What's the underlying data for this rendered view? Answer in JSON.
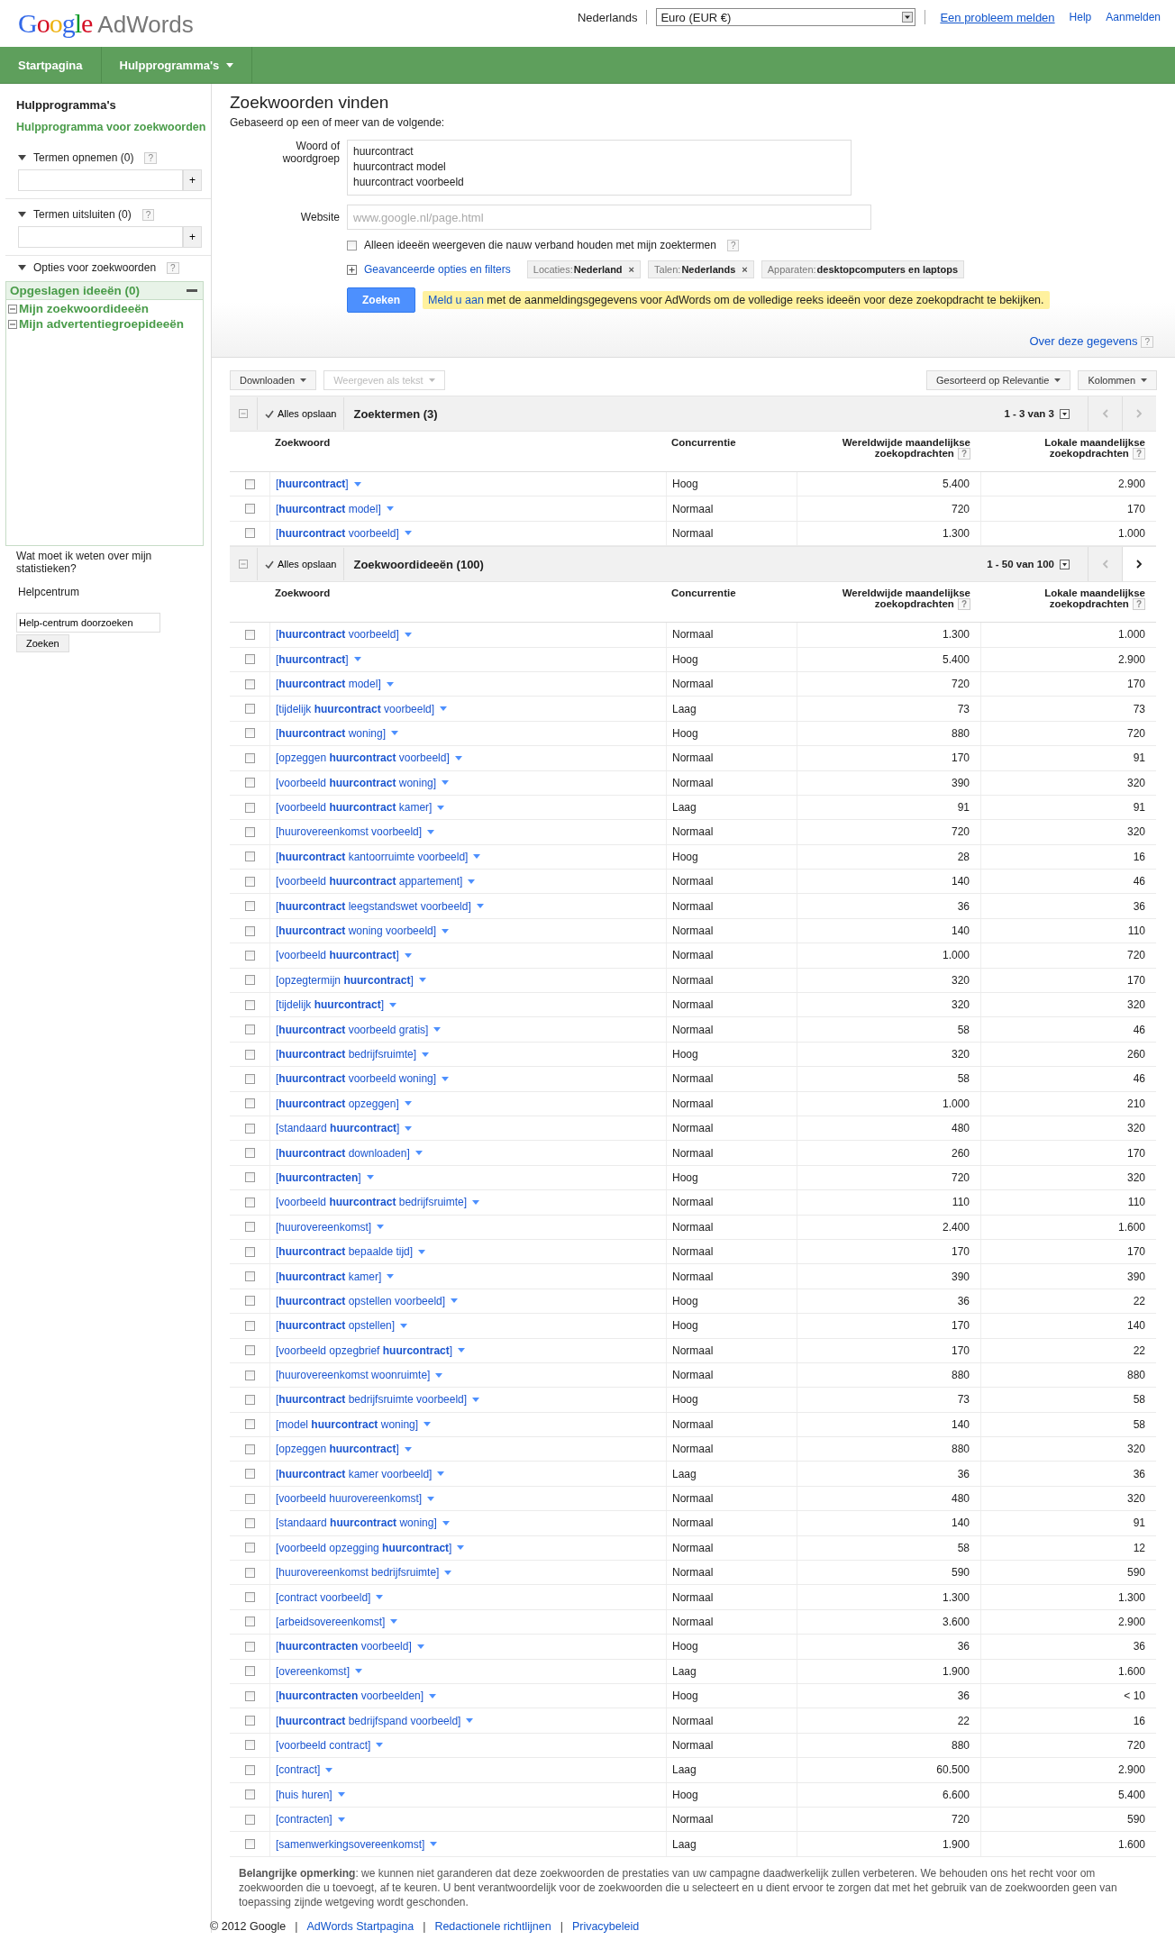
{
  "header": {
    "logo": {
      "brand": "Google",
      "product": "AdWords"
    },
    "language": "Nederlands",
    "currency": "Euro (EUR €)",
    "links": [
      "Een probleem melden",
      "Help",
      "Aanmelden"
    ]
  },
  "nav": [
    {
      "label": "Startpagina",
      "dropdown": false
    },
    {
      "label": "Hulpprogramma's",
      "dropdown": true
    }
  ],
  "sidebar": {
    "title": "Hulpprogramma's",
    "tool_link": "Hulpprogramma voor zoekwoorden",
    "term_sections": [
      {
        "label": "Termen opnemen (0)",
        "help": "?",
        "add": "+"
      },
      {
        "label": "Termen uitsluiten (0)",
        "help": "?",
        "add": "+"
      }
    ],
    "options": {
      "label": "Opties voor zoekwoorden",
      "help": "?"
    },
    "saved": {
      "title": "Opgeslagen ideeën (0)",
      "items": [
        "Mijn zoekwoordideeën",
        "Mijn advertentiegroepideeën"
      ]
    },
    "help_question": "Wat moet ik weten over mijn statistieken?",
    "help_center": "Helpcentrum",
    "help_search": {
      "value": "Help-centrum doorzoeken"
    },
    "help_button": "Zoeken"
  },
  "form": {
    "title": "Zoekwoorden vinden",
    "subtitle": "Gebaseerd op een of meer van de volgende:",
    "words_label": "Woord of woordgroep",
    "words": [
      "huurcontract",
      "huurcontract model",
      "huurcontract voorbeeld"
    ],
    "website_label": "Website",
    "website": {
      "placeholder": "www.google.nl/page.html"
    },
    "related_only": {
      "label": "Alleen ideeën weergeven die nauw verband houden met mijn zoektermen",
      "checked": false,
      "help": "?"
    },
    "advanced_link": "Geavanceerde opties en filters",
    "filters": [
      {
        "label": "Locaties:",
        "value": "Nederland",
        "remove": "×"
      },
      {
        "label": "Talen:",
        "value": "Nederlands",
        "remove": "×"
      },
      {
        "label": "Apparaten:",
        "value": "desktopcomputers en laptops"
      }
    ],
    "search_button": "Zoeken",
    "notice": {
      "link": "Meld u aan",
      "text": "met de aanmeldingsgegevens voor AdWords om de volledige reeks ideeën voor deze zoekopdracht te bekijken."
    },
    "about_link": "Over deze gegevens",
    "about_help": "?"
  },
  "toolbar": {
    "left": [
      {
        "label": "Downloaden",
        "disabled": false
      },
      {
        "label": "Weergeven als tekst",
        "disabled": true
      }
    ],
    "right": [
      {
        "label": "Gesorteerd op Relevantie",
        "disabled": false
      },
      {
        "label": "Kolommen",
        "disabled": false
      }
    ]
  },
  "tables": [
    {
      "save": "Alles opslaan",
      "title": "Zoektermen (3)",
      "pager": "1 - 3 van 3",
      "prev_disabled": true,
      "next_disabled": true,
      "columns": [
        {
          "label": "Zoekwoord"
        },
        {
          "label": "Concurrentie"
        },
        {
          "label": "Wereldwijde maandelijkse zoekopdrachten",
          "help": "?"
        },
        {
          "label": "Lokale maandelijkse zoekopdrachten",
          "help": "?"
        }
      ],
      "rows": [
        {
          "checked": false,
          "keyword": "[**huurcontract**]",
          "competition": "Hoog",
          "global": "5.400",
          "local": "2.900"
        },
        {
          "checked": false,
          "keyword": "[**huurcontract** model]",
          "competition": "Normaal",
          "global": "720",
          "local": "170"
        },
        {
          "checked": false,
          "keyword": "[**huurcontract** voorbeeld]",
          "competition": "Normaal",
          "global": "1.300",
          "local": "1.000"
        }
      ]
    },
    {
      "save": "Alles opslaan",
      "title": "Zoekwoordideeën (100)",
      "pager": "1 - 50 van 100",
      "prev_disabled": true,
      "next_disabled": false,
      "columns": [
        {
          "label": "Zoekwoord"
        },
        {
          "label": "Concurrentie"
        },
        {
          "label": "Wereldwijde maandelijkse zoekopdrachten",
          "help": "?"
        },
        {
          "label": "Lokale maandelijkse zoekopdrachten",
          "help": "?"
        }
      ],
      "rows": [
        {
          "checked": false,
          "keyword": "[**huurcontract** voorbeeld]",
          "competition": "Normaal",
          "global": "1.300",
          "local": "1.000"
        },
        {
          "checked": false,
          "keyword": "[**huurcontract**]",
          "competition": "Hoog",
          "global": "5.400",
          "local": "2.900"
        },
        {
          "checked": false,
          "keyword": "[**huurcontract** model]",
          "competition": "Normaal",
          "global": "720",
          "local": "170"
        },
        {
          "checked": false,
          "keyword": "[tijdelijk **huurcontract** voorbeeld]",
          "competition": "Laag",
          "global": "73",
          "local": "73"
        },
        {
          "checked": false,
          "keyword": "[**huurcontract** woning]",
          "competition": "Hoog",
          "global": "880",
          "local": "720"
        },
        {
          "checked": false,
          "keyword": "[opzeggen **huurcontract** voorbeeld]",
          "competition": "Normaal",
          "global": "170",
          "local": "91"
        },
        {
          "checked": false,
          "keyword": "[voorbeeld **huurcontract** woning]",
          "competition": "Normaal",
          "global": "390",
          "local": "320"
        },
        {
          "checked": false,
          "keyword": "[voorbeeld **huurcontract** kamer]",
          "competition": "Laag",
          "global": "91",
          "local": "91"
        },
        {
          "checked": false,
          "keyword": "[huurovereenkomst voorbeeld]",
          "competition": "Normaal",
          "global": "720",
          "local": "320"
        },
        {
          "checked": false,
          "keyword": "[**huurcontract** kantoorruimte voorbeeld]",
          "competition": "Hoog",
          "global": "28",
          "local": "16"
        },
        {
          "checked": false,
          "keyword": "[voorbeeld **huurcontract** appartement]",
          "competition": "Normaal",
          "global": "140",
          "local": "46"
        },
        {
          "checked": false,
          "keyword": "[**huurcontract** leegstandswet voorbeeld]",
          "competition": "Normaal",
          "global": "36",
          "local": "36"
        },
        {
          "checked": false,
          "keyword": "[**huurcontract** woning voorbeeld]",
          "competition": "Normaal",
          "global": "140",
          "local": "110"
        },
        {
          "checked": false,
          "keyword": "[voorbeeld **huurcontract**]",
          "competition": "Normaal",
          "global": "1.000",
          "local": "720"
        },
        {
          "checked": false,
          "keyword": "[opzegtermijn **huurcontract**]",
          "competition": "Normaal",
          "global": "320",
          "local": "170"
        },
        {
          "checked": false,
          "keyword": "[tijdelijk **huurcontract**]",
          "competition": "Normaal",
          "global": "320",
          "local": "320"
        },
        {
          "checked": false,
          "keyword": "[**huurcontract** voorbeeld gratis]",
          "competition": "Normaal",
          "global": "58",
          "local": "46"
        },
        {
          "checked": false,
          "keyword": "[**huurcontract** bedrijfsruimte]",
          "competition": "Hoog",
          "global": "320",
          "local": "260"
        },
        {
          "checked": false,
          "keyword": "[**huurcontract** voorbeeld woning]",
          "competition": "Normaal",
          "global": "58",
          "local": "46"
        },
        {
          "checked": false,
          "keyword": "[**huurcontract** opzeggen]",
          "competition": "Normaal",
          "global": "1.000",
          "local": "210"
        },
        {
          "checked": false,
          "keyword": "[standaard **huurcontract**]",
          "competition": "Normaal",
          "global": "480",
          "local": "320"
        },
        {
          "checked": false,
          "keyword": "[**huurcontract** downloaden]",
          "competition": "Normaal",
          "global": "260",
          "local": "170"
        },
        {
          "checked": false,
          "keyword": "[**huurcontracten**]",
          "competition": "Hoog",
          "global": "720",
          "local": "320"
        },
        {
          "checked": false,
          "keyword": "[voorbeeld **huurcontract** bedrijfsruimte]",
          "competition": "Normaal",
          "global": "110",
          "local": "110"
        },
        {
          "checked": false,
          "keyword": "[huurovereenkomst]",
          "competition": "Normaal",
          "global": "2.400",
          "local": "1.600"
        },
        {
          "checked": false,
          "keyword": "[**huurcontract** bepaalde tijd]",
          "competition": "Normaal",
          "global": "170",
          "local": "170"
        },
        {
          "checked": false,
          "keyword": "[**huurcontract** kamer]",
          "competition": "Normaal",
          "global": "390",
          "local": "390"
        },
        {
          "checked": false,
          "keyword": "[**huurcontract** opstellen voorbeeld]",
          "competition": "Hoog",
          "global": "36",
          "local": "22"
        },
        {
          "checked": false,
          "keyword": "[**huurcontract** opstellen]",
          "competition": "Hoog",
          "global": "170",
          "local": "140"
        },
        {
          "checked": false,
          "keyword": "[voorbeeld opzegbrief **huurcontract**]",
          "competition": "Normaal",
          "global": "170",
          "local": "22"
        },
        {
          "checked": false,
          "keyword": "[huurovereenkomst woonruimte]",
          "competition": "Normaal",
          "global": "880",
          "local": "880"
        },
        {
          "checked": false,
          "keyword": "[**huurcontract** bedrijfsruimte voorbeeld]",
          "competition": "Hoog",
          "global": "73",
          "local": "58"
        },
        {
          "checked": false,
          "keyword": "[model **huurcontract** woning]",
          "competition": "Normaal",
          "global": "140",
          "local": "58"
        },
        {
          "checked": false,
          "keyword": "[opzeggen **huurcontract**]",
          "competition": "Normaal",
          "global": "880",
          "local": "320"
        },
        {
          "checked": false,
          "keyword": "[**huurcontract** kamer voorbeeld]",
          "competition": "Laag",
          "global": "36",
          "local": "36"
        },
        {
          "checked": false,
          "keyword": "[voorbeeld huurovereenkomst]",
          "competition": "Normaal",
          "global": "480",
          "local": "320"
        },
        {
          "checked": false,
          "keyword": "[standaard **huurcontract** woning]",
          "competition": "Normaal",
          "global": "140",
          "local": "91"
        },
        {
          "checked": false,
          "keyword": "[voorbeeld opzegging **huurcontract**]",
          "competition": "Normaal",
          "global": "58",
          "local": "12"
        },
        {
          "checked": false,
          "keyword": "[huurovereenkomst bedrijfsruimte]",
          "competition": "Normaal",
          "global": "590",
          "local": "590"
        },
        {
          "checked": false,
          "keyword": "[contract voorbeeld]",
          "competition": "Normaal",
          "global": "1.300",
          "local": "1.300"
        },
        {
          "checked": false,
          "keyword": "[arbeidsovereenkomst]",
          "competition": "Normaal",
          "global": "3.600",
          "local": "2.900"
        },
        {
          "checked": false,
          "keyword": "[**huurcontracten** voorbeeld]",
          "competition": "Hoog",
          "global": "36",
          "local": "36"
        },
        {
          "checked": false,
          "keyword": "[overeenkomst]",
          "competition": "Laag",
          "global": "1.900",
          "local": "1.600"
        },
        {
          "checked": false,
          "keyword": "[**huurcontracten** voorbeelden]",
          "competition": "Hoog",
          "global": "36",
          "local": "< 10"
        },
        {
          "checked": false,
          "keyword": "[**huurcontract** bedrijfspand voorbeeld]",
          "competition": "Normaal",
          "global": "22",
          "local": "16"
        },
        {
          "checked": false,
          "keyword": "[voorbeeld contract]",
          "competition": "Normaal",
          "global": "880",
          "local": "720"
        },
        {
          "checked": false,
          "keyword": "[contract]",
          "competition": "Laag",
          "global": "60.500",
          "local": "2.900"
        },
        {
          "checked": false,
          "keyword": "[huis huren]",
          "competition": "Hoog",
          "global": "6.600",
          "local": "5.400"
        },
        {
          "checked": false,
          "keyword": "[contracten]",
          "competition": "Normaal",
          "global": "720",
          "local": "590"
        },
        {
          "checked": false,
          "keyword": "[samenwerkingsovereenkomst]",
          "competition": "Laag",
          "global": "1.900",
          "local": "1.600"
        }
      ]
    }
  ],
  "note": "**Belangrijke opmerking**: we kunnen niet garanderen dat deze zoekwoorden de prestaties van uw campagne daadwerkelijk zullen verbeteren. We behouden ons het recht voor om zoekwoorden die u toevoegt, af te keuren. U bent verantwoordelijk voor de zoekwoorden die u selecteert en u dient ervoor te zorgen dat met het gebruik van de zoekwoorden geen van toepassing zijnde wetgeving wordt geschonden.",
  "footer": {
    "copyright": "© 2012 Google",
    "separator": "|",
    "links": [
      "AdWords Startpagina",
      "Redactionele richtlijnen",
      "Privacybeleid"
    ]
  }
}
